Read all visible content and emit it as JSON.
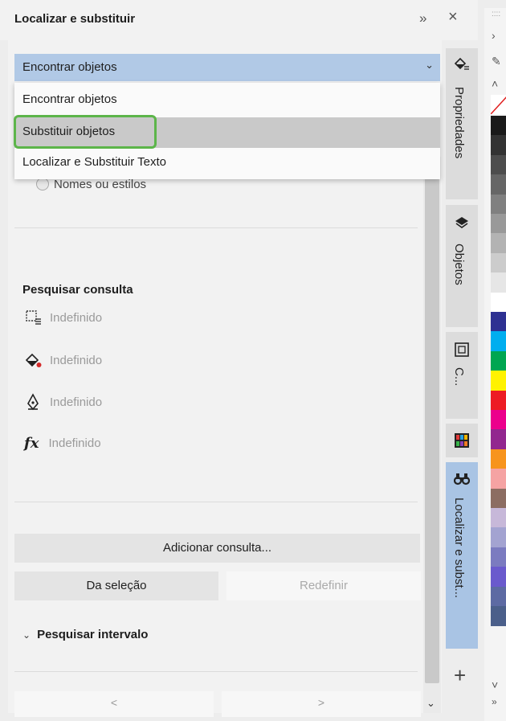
{
  "header": {
    "title": "Localizar e substituir",
    "expand_glyph": "»",
    "close_glyph": "×"
  },
  "dropdown": {
    "value": "Encontrar objetos",
    "options": [
      "Encontrar objetos",
      "Substituir objetos",
      "Localizar e Substituir Texto"
    ],
    "selected_option": "Substituir objetos"
  },
  "radio_partial": "Nomes ou estilos",
  "query": {
    "title": "Pesquisar consulta",
    "rows": [
      {
        "icon": "object-type-icon",
        "value": "Indefinido"
      },
      {
        "icon": "fill-icon",
        "value": "Indefinido"
      },
      {
        "icon": "pen-outline-icon",
        "value": "Indefinido"
      },
      {
        "icon": "fx-icon",
        "glyph": "fx",
        "value": "Indefinido"
      }
    ]
  },
  "buttons": {
    "add_query": "Adicionar consulta...",
    "from_selection": "Da seleção",
    "reset": "Redefinir"
  },
  "range": {
    "label": "Pesquisar intervalo",
    "chevron": "⌄"
  },
  "nav": {
    "prev": "<",
    "next": ">"
  },
  "dock_tabs": [
    {
      "label": "Propriedades",
      "icon": "properties-icon"
    },
    {
      "label": "Objetos",
      "icon": "layers-icon"
    },
    {
      "label": "C...",
      "icon": "frame-icon"
    },
    {
      "label": "Localizar e subst...",
      "icon": "binoculars-icon",
      "active": true
    }
  ],
  "dock_add": "+",
  "palette": {
    "colors": [
      "#1a1a1a",
      "#333333",
      "#4d4d4d",
      "#666666",
      "#808080",
      "#999999",
      "#b3b3b3",
      "#cccccc",
      "#e6e6e6",
      "#ffffff",
      "#2e3192",
      "#00aeef",
      "#00a651",
      "#fff200",
      "#ed1c24",
      "#ec008c",
      "#92278f",
      "#f7941d",
      "#f5a3a3",
      "#8c6d62",
      "#c7b8d9",
      "#a3a3d1",
      "#7b7bc0",
      "#6a5acd",
      "#5d6aa3",
      "#4b5f8a"
    ]
  },
  "colors": {
    "accent": "#a9c4e4",
    "highlight_border": "#5cb54a"
  }
}
